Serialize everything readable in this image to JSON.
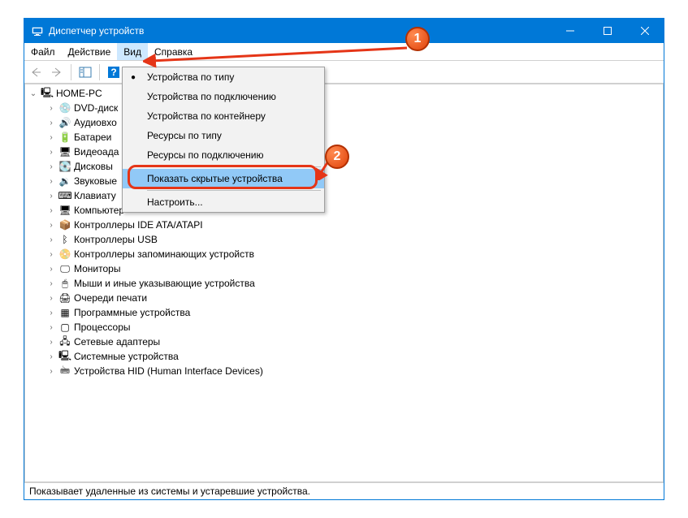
{
  "titlebar": {
    "title": "Диспетчер устройств"
  },
  "menubar": {
    "file": "Файл",
    "action": "Действие",
    "view": "Вид",
    "help": "Справка"
  },
  "dropdown": {
    "devices_by_type": "Устройства по типу",
    "devices_by_connection": "Устройства по подключению",
    "devices_by_container": "Устройства по контейнеру",
    "resources_by_type": "Ресурсы по типу",
    "resources_by_connection": "Ресурсы по подключению",
    "show_hidden": "Показать скрытые устройства",
    "customize": "Настроить..."
  },
  "tree": {
    "root": "HOME-PC",
    "items": [
      {
        "label": "DVD-диск",
        "icon": "💿"
      },
      {
        "label": "Аудиовхо",
        "icon": "🔊"
      },
      {
        "label": "Батареи",
        "icon": "🔋"
      },
      {
        "label": "Видеоада",
        "icon": "🖥"
      },
      {
        "label": "Дисковы",
        "icon": "💽"
      },
      {
        "label": "Звуковые",
        "icon": "🔉"
      },
      {
        "label": "Клавиату",
        "icon": "⌨"
      },
      {
        "label": "Компьютер",
        "icon": "🖥"
      },
      {
        "label": "Контроллеры IDE ATA/ATAPI",
        "icon": "📦"
      },
      {
        "label": "Контроллеры USB",
        "icon": "ᛒ"
      },
      {
        "label": "Контроллеры запоминающих устройств",
        "icon": "📀"
      },
      {
        "label": "Мониторы",
        "icon": "🖵"
      },
      {
        "label": "Мыши и иные указывающие устройства",
        "icon": "🖱"
      },
      {
        "label": "Очереди печати",
        "icon": "🖨"
      },
      {
        "label": "Программные устройства",
        "icon": "▦"
      },
      {
        "label": "Процессоры",
        "icon": "▢"
      },
      {
        "label": "Сетевые адаптеры",
        "icon": "🖧"
      },
      {
        "label": "Системные устройства",
        "icon": "🖳"
      },
      {
        "label": "Устройства HID (Human Interface Devices)",
        "icon": "🖮"
      }
    ]
  },
  "statusbar": {
    "text": "Показывает удаленные из системы и устаревшие устройства."
  },
  "callouts": {
    "one": "1",
    "two": "2"
  }
}
